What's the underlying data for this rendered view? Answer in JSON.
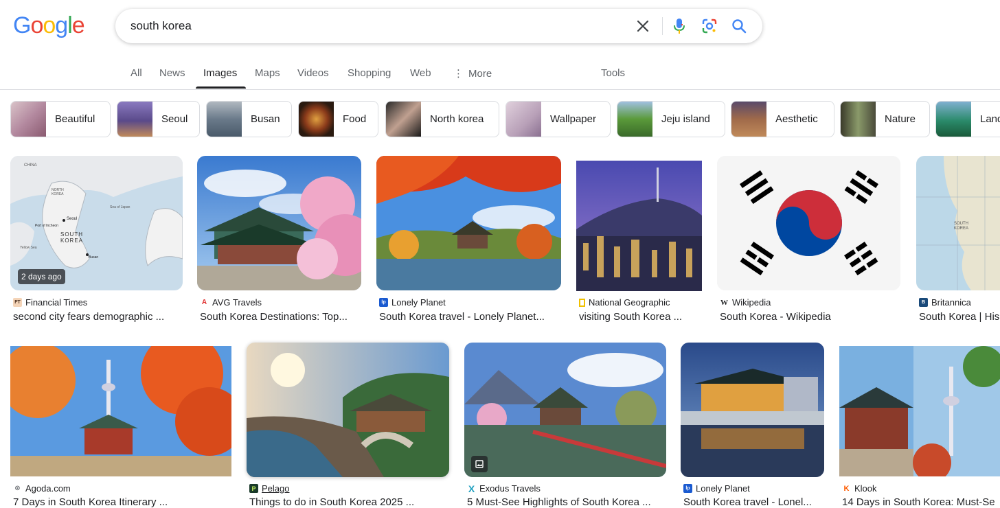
{
  "header": {
    "logo": [
      "G",
      "o",
      "o",
      "g",
      "l",
      "e"
    ],
    "search_value": "south korea"
  },
  "nav": {
    "tabs": [
      "All",
      "News",
      "Images",
      "Maps",
      "Videos",
      "Shopping",
      "Web",
      "More"
    ],
    "active": "Images",
    "tools": "Tools"
  },
  "chips": [
    {
      "label": "Beautiful",
      "color": "#b8a0b0"
    },
    {
      "label": "Seoul",
      "color": "#6a5a9a"
    },
    {
      "label": "Busan",
      "color": "#7d8a96"
    },
    {
      "label": "Food",
      "color": "#5a3a20"
    },
    {
      "label": "North korea",
      "color": "#3a3030"
    },
    {
      "label": "Wallpaper",
      "color": "#c8b8c8"
    },
    {
      "label": "Jeju island",
      "color": "#6a9a4a"
    },
    {
      "label": "Aesthetic",
      "color": "#8a6a5a"
    },
    {
      "label": "Nature",
      "color": "#6a7a50"
    },
    {
      "label": "Land",
      "color": "#2a8a7a"
    }
  ],
  "results": [
    {
      "source": "Financial Times",
      "caption": "second city fears demographic ...",
      "badge": "2 days ago",
      "favicon": "FT"
    },
    {
      "source": "AVG Travels",
      "caption": "South Korea Destinations: Top...",
      "favicon": "A"
    },
    {
      "source": "Lonely Planet",
      "caption": "South Korea travel - Lonely Planet...",
      "favicon": "lp"
    },
    {
      "source": "National Geographic",
      "caption": "visiting South Korea ...",
      "favicon": ""
    },
    {
      "source": "Wikipedia",
      "caption": "South Korea - Wikipedia",
      "favicon": "W"
    },
    {
      "source": "Britannica",
      "caption": "South Korea | His",
      "favicon": "B"
    },
    {
      "source": "Agoda.com",
      "caption": "7 Days in South Korea Itinerary ...",
      "favicon": "a"
    },
    {
      "source": "Pelago",
      "caption": "Things to do in South Korea 2025 ...",
      "favicon": "P"
    },
    {
      "source": "Exodus Travels",
      "caption": "5 Must-See Highlights of South Korea ...",
      "favicon": "X"
    },
    {
      "source": "Lonely Planet",
      "caption": "South Korea travel - Lonel...",
      "favicon": "lp"
    },
    {
      "source": "Klook",
      "caption": "14 Days in South Korea: Must-Se",
      "favicon": "K"
    }
  ],
  "map_labels": {
    "china": "CHINA",
    "north_korea": "NORTH KOREA",
    "sea_of_japan": "Sea of Japan",
    "seoul": "Seoul",
    "incheon": "Port of Incheon",
    "south_korea": "SOUTH KOREA",
    "busan": "Busan",
    "yellow_sea": "Yellow Sea"
  },
  "colors": {
    "text": "#202124",
    "muted": "#5f6368",
    "border": "#dadce0",
    "flag_red": "#cd2e3a",
    "flag_blue": "#0047a0"
  }
}
